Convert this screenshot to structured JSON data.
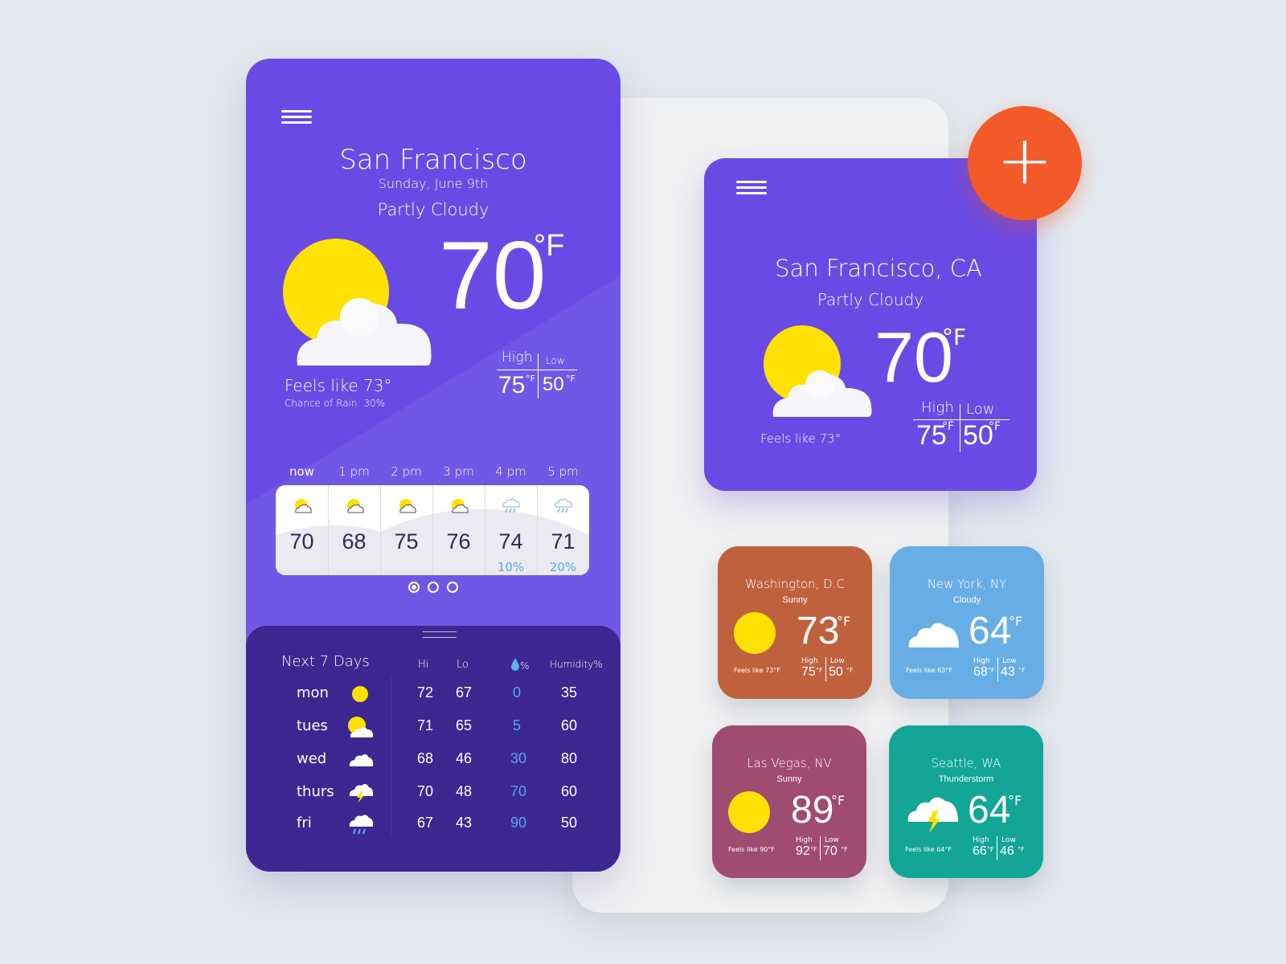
{
  "main": {
    "city": "San Francisco",
    "date": "Sunday, June 9th",
    "condition": "Partly Cloudy",
    "temp": "70",
    "unit": "°F",
    "feels_like": "Feels like 73°",
    "rain": "Chance of Rain: 30%",
    "high_label": "High",
    "low_label": "Low",
    "high": "75",
    "low": "50",
    "hl_unit": "°F",
    "hours": [
      {
        "label": "now",
        "temp": "70",
        "rain": "",
        "icon": "partly-cloudy-icon"
      },
      {
        "label": "1 pm",
        "temp": "68",
        "rain": "",
        "icon": "partly-cloudy-icon"
      },
      {
        "label": "2 pm",
        "temp": "75",
        "rain": "",
        "icon": "partly-cloudy-icon"
      },
      {
        "label": "3 pm",
        "temp": "76",
        "rain": "",
        "icon": "partly-cloudy-icon"
      },
      {
        "label": "4 pm",
        "temp": "74",
        "rain": "10%",
        "icon": "rain-icon"
      },
      {
        "label": "5 pm",
        "temp": "71",
        "rain": "20%",
        "icon": "rain-icon"
      }
    ],
    "page_dots": 3
  },
  "week": {
    "title": "Next 7 Days",
    "col_hi": "Hi",
    "col_lo": "Lo",
    "col_rain": "%",
    "col_humidity": "Humidity%",
    "days": [
      {
        "day": "mon",
        "hi": "72",
        "lo": "67",
        "rain": "0",
        "humidity": "35",
        "icon": "sun-icon"
      },
      {
        "day": "tues",
        "hi": "71",
        "lo": "65",
        "rain": "5",
        "humidity": "60",
        "icon": "partly-cloudy-icon"
      },
      {
        "day": "wed",
        "hi": "68",
        "lo": "46",
        "rain": "30",
        "humidity": "80",
        "icon": "cloud-icon"
      },
      {
        "day": "thurs",
        "hi": "70",
        "lo": "48",
        "rain": "70",
        "humidity": "60",
        "icon": "thunderstorm-icon"
      },
      {
        "day": "fri",
        "hi": "67",
        "lo": "43",
        "rain": "90",
        "humidity": "50",
        "icon": "rain-icon"
      }
    ]
  },
  "widget": {
    "city": "San Francisco, CA",
    "condition": "Partly Cloudy",
    "temp": "70",
    "unit": "°F",
    "feels_like": "Feels like 73°",
    "high_label": "High",
    "low_label": "Low",
    "high": "75",
    "low": "50",
    "hl_unit": "°F",
    "add_label": "+"
  },
  "minis": [
    {
      "city": "Washington, D.C",
      "condition": "Sunny",
      "temp": "73",
      "unit": "°F",
      "feels": "Feels like 73°F",
      "high": "75",
      "low": "50",
      "color": "#c0613e"
    },
    {
      "city": "New York, NY",
      "condition": "Cloudy",
      "temp": "64",
      "unit": "°F",
      "feels": "Feels like 63°F",
      "high": "68",
      "low": "43",
      "color": "#68aee6"
    },
    {
      "city": "Las Vegas, NV",
      "condition": "Sunny",
      "temp": "89",
      "unit": "°F",
      "feels": "Feels like 90°F",
      "high": "92",
      "low": "70",
      "color": "#a04b70"
    },
    {
      "city": "Seattle, WA",
      "condition": "Thunderstorm",
      "temp": "64",
      "unit": "°F",
      "feels": "Feels like 64°F",
      "high": "66",
      "low": "46",
      "color": "#13a596"
    }
  ],
  "mini_labels": {
    "high": "High",
    "low": "Low",
    "deg": "°F"
  },
  "colors": {
    "accent": "#6a4ae5",
    "fab": "#f25a2a",
    "sun": "#ffe203",
    "rain_text": "#56a9e6",
    "panel": "#3d2790"
  }
}
